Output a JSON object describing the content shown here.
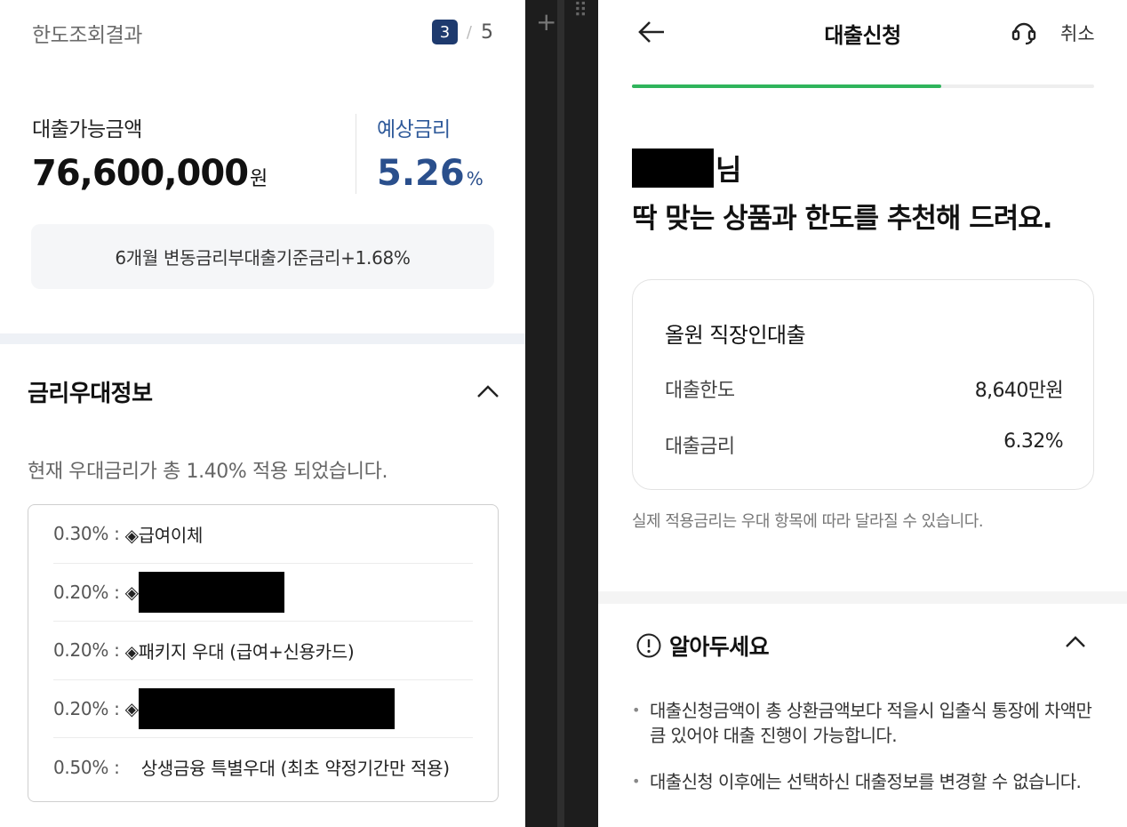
{
  "left": {
    "title": "한도조회결과",
    "pager": {
      "current": "3",
      "separator": "/",
      "total": "5"
    },
    "amount_label": "대출가능금액",
    "amount_value": "76,600,000",
    "amount_unit": "원",
    "rate_label": "예상금리",
    "rate_value": "5.26",
    "rate_unit": "%",
    "rate_basis": "6개월 변동금리부대출기준금리+1.68%",
    "section_title": "금리우대정보",
    "applied_text": "현재 우대금리가 총 1.40% 적용 되었습니다.",
    "preferences": [
      {
        "pct": "0.30% : ",
        "name": "◈급여이체"
      },
      {
        "pct": "0.20% : ",
        "name": "◈"
      },
      {
        "pct": "0.20% : ",
        "name": "◈패키지 우대 (급여+신용카드)"
      },
      {
        "pct": "0.20% : ",
        "name": "◈"
      },
      {
        "pct": "0.50% :    ",
        "name": "상생금융 특별우대 (최초 약정기간만 적용)"
      }
    ]
  },
  "right": {
    "title": "대출신청",
    "cancel_label": "취소",
    "progress": 0.67,
    "progress_color": "#2fb45c",
    "greeting_suffix": "님",
    "greeting_message": "딱 맞는 상품과 한도를 추천해 드려요.",
    "product": {
      "name": "올원 직장인대출",
      "limit_label": "대출한도",
      "limit_value": "8,640만원",
      "rate_label": "대출금리",
      "rate_value": "6.32%"
    },
    "notice": "실제 적용금리는 우대 항목에 따라 달라질 수 있습니다.",
    "know_title": "알아두세요",
    "bullets": [
      "대출신청금액이 총 상환금액보다 적을시 입출식 통장에 차액만큼 있어야 대출 진행이 가능합니다.",
      "대출신청 이후에는 선택하신 대출정보를 변경할 수 없습니다."
    ]
  },
  "icons": {
    "back": "arrow-left-icon",
    "support": "headset-icon",
    "collapse": "chevron-up-icon",
    "info": "info-circle-icon"
  },
  "colors": {
    "pager_badge": "#1e3a6e",
    "rate_blue": "#2a4f8c",
    "progress_green": "#2fb45c"
  }
}
